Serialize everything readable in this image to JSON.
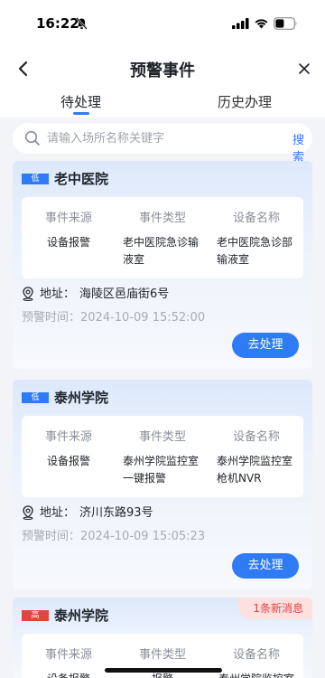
{
  "status_bar": {
    "time": "16:22"
  },
  "nav": {
    "title": "预警事件"
  },
  "tabs": [
    {
      "label": "待处理",
      "active": true
    },
    {
      "label": "历史办理",
      "active": false
    }
  ],
  "search": {
    "placeholder": "请输入场所名称关键字",
    "button_label": "搜索"
  },
  "columns": [
    "事件来源",
    "事件类型",
    "设备名称"
  ],
  "labels": {
    "address": "地址：",
    "alert_time": "预警时间：",
    "process_button": "去处理"
  },
  "cards": [
    {
      "level": "低",
      "name": "老中医院",
      "source": "设备报警",
      "event_type": "老中医院急诊输液室",
      "device_name": "老中医院急诊部输液室",
      "address": "海陵区邑庙街6号",
      "alert_time": "2024-10-09 15:52:00"
    },
    {
      "level": "低",
      "name": "泰州学院",
      "source": "设备报警",
      "event_type": "泰州学院监控室一键报警",
      "device_name": "泰州学院监控室枪机NVR",
      "address": "济川东路93号",
      "alert_time": "2024-10-09 15:05:23"
    },
    {
      "level": "高",
      "name": "泰州学院",
      "new_messages": "1条新消息",
      "source": "设备报警",
      "event_type": "报警",
      "device_name": "泰州学院监控室"
    }
  ],
  "colors": {
    "accent": "#2f7bf5",
    "level_low": "#2f7bf5",
    "level_high": "#e2443f"
  }
}
